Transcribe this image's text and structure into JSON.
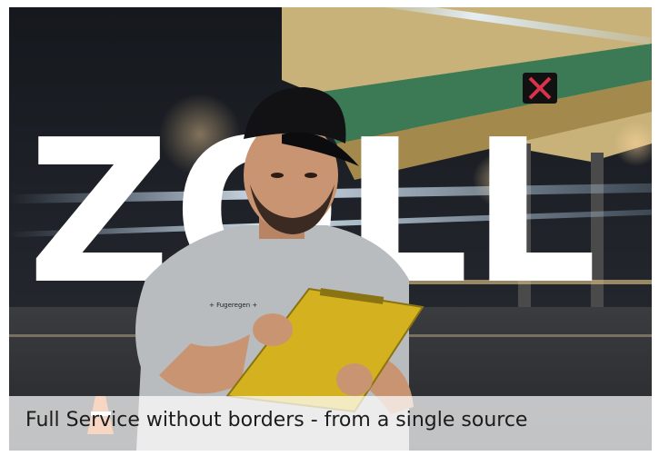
{
  "hero": {
    "background_word": "ZOLL",
    "caption": "Full Service without borders - from a single source",
    "shirt_logo_text": "+ Fugeregen +"
  },
  "colors": {
    "canopy": "#c8b27a",
    "sky": "#1b1f27",
    "light_streak": "#d8ecff",
    "clipboard": "#d4b21f",
    "cap": "#121215",
    "shirt": "#b9bcbf",
    "skin": "#c99472",
    "caption_bg": "#ffffff",
    "caption_text": "#1c1c1c"
  },
  "icons": {
    "traffic_signal": "red-x-icon"
  }
}
